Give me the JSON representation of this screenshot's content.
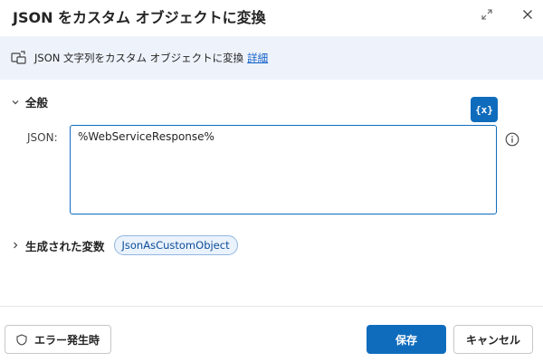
{
  "dialog": {
    "title": "JSON をカスタム オブジェクトに変換"
  },
  "info_bar": {
    "icon": "convert-icon",
    "text": "JSON 文字列をカスタム オブジェクトに変換",
    "link": "詳細"
  },
  "general_section": {
    "label": "全般",
    "variable_button": "{x}"
  },
  "json_field": {
    "label": "JSON:",
    "value": "%WebServiceResponse%"
  },
  "produced_variables": {
    "label": "生成された変数",
    "variable": "JsonAsCustomObject"
  },
  "footer": {
    "error_button": "エラー発生時",
    "save_button": "保存",
    "cancel_button": "キャンセル"
  },
  "colors": {
    "accent": "#0f6cbd",
    "info_bar_bg": "#eef3fb",
    "link": "#0f5ec7"
  }
}
